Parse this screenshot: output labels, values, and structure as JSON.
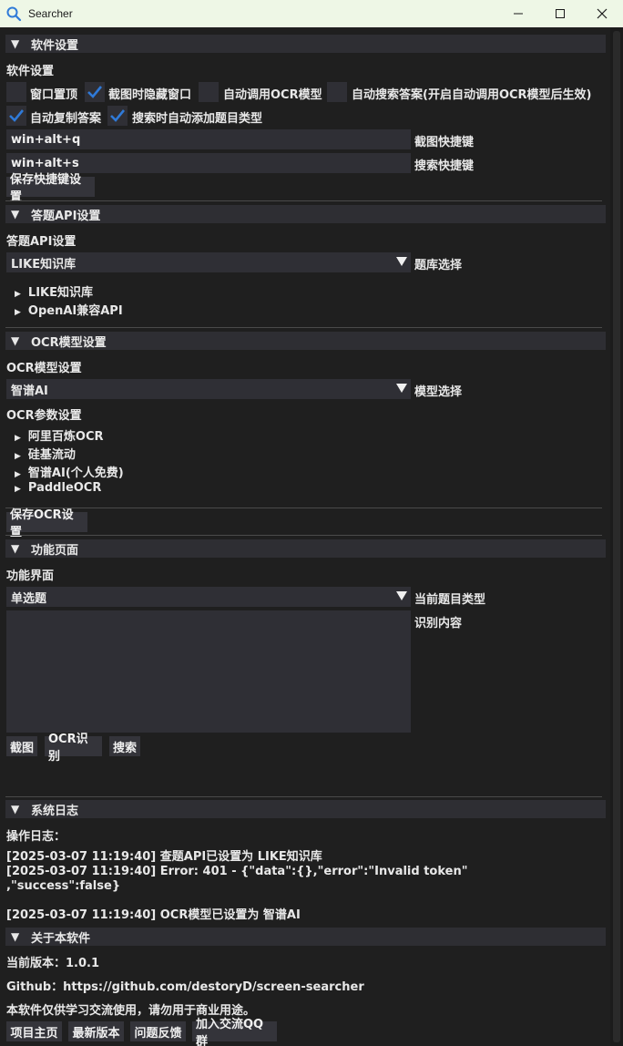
{
  "window": {
    "title": "Searcher"
  },
  "software": {
    "header": "软件设置",
    "label": "软件设置",
    "checkboxes": [
      {
        "label": "窗口置顶",
        "checked": false
      },
      {
        "label": "截图时隐藏窗口",
        "checked": true
      },
      {
        "label": "自动调用OCR模型",
        "checked": false
      },
      {
        "label": "自动搜索答案(开启自动调用OCR模型后生效)",
        "checked": false
      },
      {
        "label": "自动复制答案",
        "checked": true
      },
      {
        "label": "搜索时自动添加题目类型",
        "checked": true
      }
    ],
    "capture_hotkey": "win+alt+q",
    "capture_hotkey_label": "截图快捷键",
    "search_hotkey": "win+alt+s",
    "search_hotkey_label": "搜索快捷键",
    "save_button": "保存快捷键设置"
  },
  "api": {
    "header": "答题API设置",
    "label": "答题API设置",
    "selected": "LIKE知识库",
    "select_label": "题库选择",
    "tree": [
      "LIKE知识库",
      "OpenAI兼容API"
    ]
  },
  "ocr": {
    "header": "OCR模型设置",
    "label": "OCR模型设置",
    "selected": "智谱AI",
    "select_label": "模型选择",
    "params_label": "OCR参数设置",
    "tree": [
      "阿里百炼OCR",
      "硅基流动",
      "智谱AI(个人免费)",
      "PaddleOCR"
    ],
    "save_button": "保存OCR设置"
  },
  "function": {
    "header": "功能页面",
    "label": "功能界面",
    "selected": "单选题",
    "select_label": "当前题目类型",
    "text_label": "识别内容",
    "buttons": [
      "截图",
      "OCR识别",
      "搜索"
    ]
  },
  "log": {
    "header": "系统日志",
    "label": "操作日志：",
    "entries": [
      "[2025-03-07 11:19:40] 查题API已设置为 LIKE知识库",
      "[2025-03-07 11:19:40] Error: 401 - {\"data\":{},\"error\":\"Invalid token\"",
      ",\"success\":false}",
      "[2025-03-07 11:19:40] OCR模型已设置为 智谱AI"
    ]
  },
  "about": {
    "header": "关于本软件",
    "version": "当前版本：1.0.1",
    "github": "Github：https://github.com/destoryD/screen-searcher",
    "notice": "本软件仅供学习交流使用，请勿用于商业用途。",
    "buttons": [
      "项目主页",
      "最新版本",
      "问题反馈",
      "加入交流QQ群"
    ]
  },
  "colors": {
    "titlebar_bg": "#eef7e6",
    "window_bg": "#1f1f1f",
    "header_bg": "#2e2e33",
    "field_bg": "#2f2f35",
    "check_accent": "#2f7ad8"
  }
}
